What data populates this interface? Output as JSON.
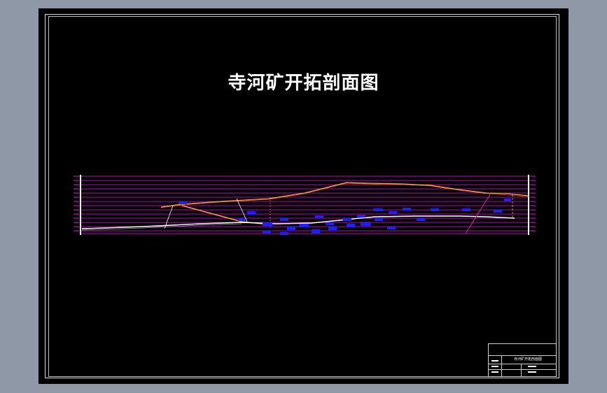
{
  "drawing": {
    "title": "寺河矿开拓剖面图",
    "title_block": {
      "drawing_name": "寺河矿开拓剖面图"
    }
  },
  "colors": {
    "background": "#000000",
    "window_bg": "#8e98a6",
    "grid_lines": "#ff00ff",
    "surface_line": "#ffa040",
    "seam_line": "#ffffff",
    "roadway_labels": "#1e1eff",
    "fault_line": "#cc3399"
  },
  "icons": []
}
